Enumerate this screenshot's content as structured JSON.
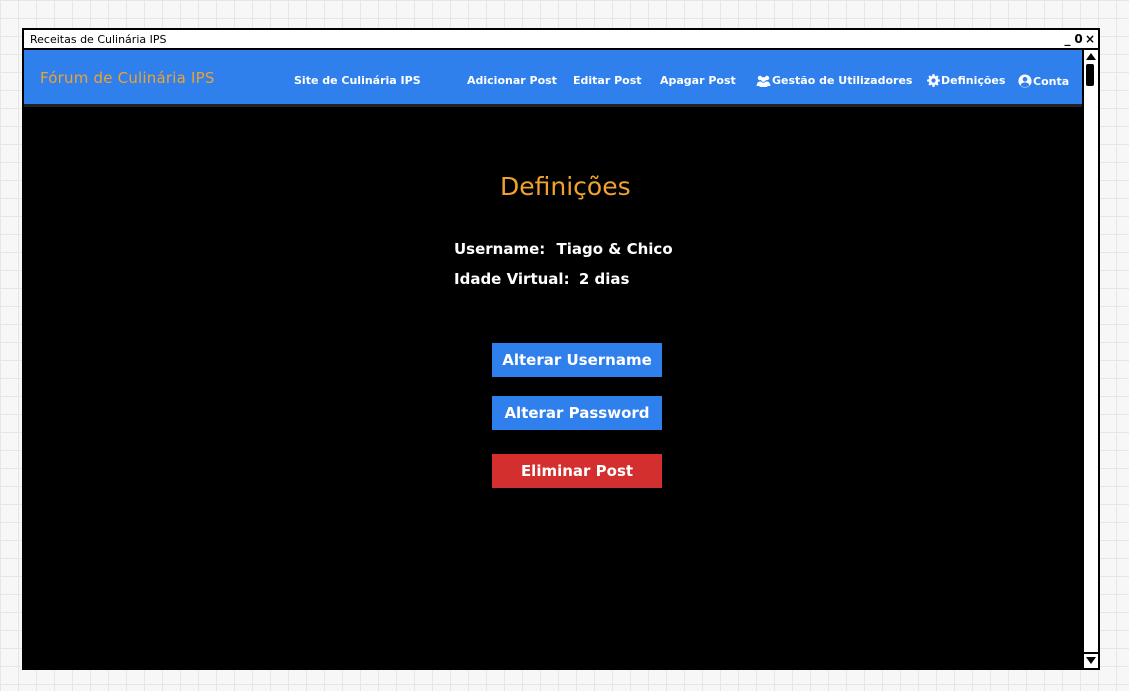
{
  "window": {
    "title": "Receitas de Culinária IPS",
    "controls": [
      "_",
      "0",
      "×"
    ]
  },
  "navbar": {
    "brand": "Fórum de Culinária IPS",
    "items": [
      {
        "label": "Site de Culinária IPS",
        "icon": ""
      },
      {
        "label": "Adicionar Post",
        "icon": ""
      },
      {
        "label": "Editar Post",
        "icon": ""
      },
      {
        "label": "Apagar Post",
        "icon": ""
      },
      {
        "label": "Gestão de Utilizadores",
        "icon": "users-icon"
      },
      {
        "label": "Definições",
        "icon": "gear-icon"
      },
      {
        "label": "Conta",
        "icon": "user-circle-icon"
      }
    ]
  },
  "main": {
    "title": "Definições",
    "username_label": "Username:",
    "username_value": "Tiago & Chico",
    "age_label": "Idade Virtual:",
    "age_value": "2 dias",
    "buttons": {
      "change_username": "Alterar Username",
      "change_password": "Alterar Password",
      "delete_post": "Eliminar Post"
    }
  },
  "colors": {
    "navbar": "#2f80ed",
    "brand": "#f0a22e",
    "heading": "#f0a22e",
    "danger": "#d32f2f",
    "background": "#000000"
  }
}
